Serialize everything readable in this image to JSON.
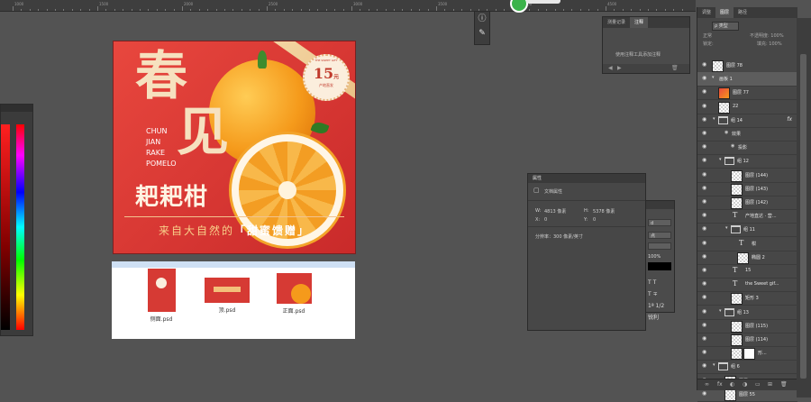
{
  "ruler": {
    "ticks": [
      "1000",
      "1500",
      "2000",
      "2500",
      "3000",
      "3500",
      "4000",
      "4500"
    ]
  },
  "artwork": {
    "big_chars": [
      "春",
      "见"
    ],
    "pinyin": [
      "CHUN",
      "JIAN",
      "RAKE",
      "POMELO"
    ],
    "name": "耙耙柑",
    "slogan_pre": "来自大自然的",
    "slogan_hl": "「甜蜜馈赠」",
    "seal_num": "15",
    "seal_unit": "元",
    "seal_sub": "产地直发",
    "seal_top": "THE SWEET GIFT"
  },
  "thumbnails": [
    {
      "label": "侧面.psd"
    },
    {
      "label": "顶.psd"
    },
    {
      "label": "正面.psd"
    }
  ],
  "notes_panel": {
    "tabs": [
      "测量记录",
      "注释"
    ],
    "message": "使用注释工具添加注释",
    "foot": [
      "◀",
      "▶",
      "🗑"
    ]
  },
  "properties": {
    "title": "属性",
    "section": "文档属性",
    "w_label": "W:",
    "w_value": "4813 像素",
    "h_label": "H:",
    "h_value": "5378 像素",
    "x_label": "X:",
    "x_value": "0",
    "y_label": "Y:",
    "y_value": "0",
    "resolution": "分辨率：300 像素/英寸"
  },
  "side_panel": {
    "fields": [
      "d",
      "点",
      "",
      "",
      ""
    ],
    "pct": "100%",
    "glyphs": [
      "T  T",
      "T  ∓",
      "1ª  1/2",
      "锐利"
    ]
  },
  "layers_panel": {
    "tabs": [
      "调整",
      "图层",
      "路径"
    ],
    "filter": "ρ 类型",
    "mode": "正常",
    "opacity": "不透明度: 100%",
    "lock": "锁定:",
    "fill": "填充: 100%",
    "layers": [
      {
        "name": "图层 78",
        "kind": "thumb",
        "indent": 0
      },
      {
        "name": "画板 1",
        "kind": "arrow",
        "indent": 0
      },
      {
        "name": "图层 77",
        "kind": "img",
        "indent": 1
      },
      {
        "name": "22",
        "kind": "thumb",
        "indent": 1
      },
      {
        "name": "组 14",
        "kind": "folder",
        "indent": 1,
        "fx": "fx"
      },
      {
        "name": "效果",
        "kind": "sub",
        "indent": 2
      },
      {
        "name": "投影",
        "kind": "sub",
        "indent": 3
      },
      {
        "name": "组 12",
        "kind": "folder",
        "indent": 2
      },
      {
        "name": "图层 (144)",
        "kind": "thumb",
        "indent": 3
      },
      {
        "name": "图层 (143)",
        "kind": "thumb",
        "indent": 3
      },
      {
        "name": "图层 (142)",
        "kind": "thumb",
        "indent": 3
      },
      {
        "name": "产地直达 · 营...",
        "kind": "text",
        "indent": 3
      },
      {
        "name": "组 11",
        "kind": "folder",
        "indent": 3
      },
      {
        "name": "柑",
        "kind": "text",
        "indent": 4
      },
      {
        "name": "椭圆 2",
        "kind": "thumb",
        "indent": 4
      },
      {
        "name": "15",
        "kind": "text",
        "indent": 3
      },
      {
        "name": "the Sweet gif...",
        "kind": "text",
        "indent": 3
      },
      {
        "name": "矩形 3",
        "kind": "thumb",
        "indent": 3
      },
      {
        "name": "组 13",
        "kind": "folder",
        "indent": 2
      },
      {
        "name": "图层 (115)",
        "kind": "thumb",
        "indent": 3
      },
      {
        "name": "图层 (114)",
        "kind": "thumb",
        "indent": 3
      },
      {
        "name": "形...",
        "kind": "mask",
        "indent": 3
      },
      {
        "name": "组 6",
        "kind": "folder",
        "indent": 1
      },
      {
        "name": "图层 56",
        "kind": "thumb",
        "indent": 2
      },
      {
        "name": "图层 55",
        "kind": "thumb",
        "indent": 2
      }
    ],
    "foot": [
      "∞",
      "fx",
      "◐",
      "◑",
      "▭",
      "⊞",
      "🗑"
    ]
  }
}
